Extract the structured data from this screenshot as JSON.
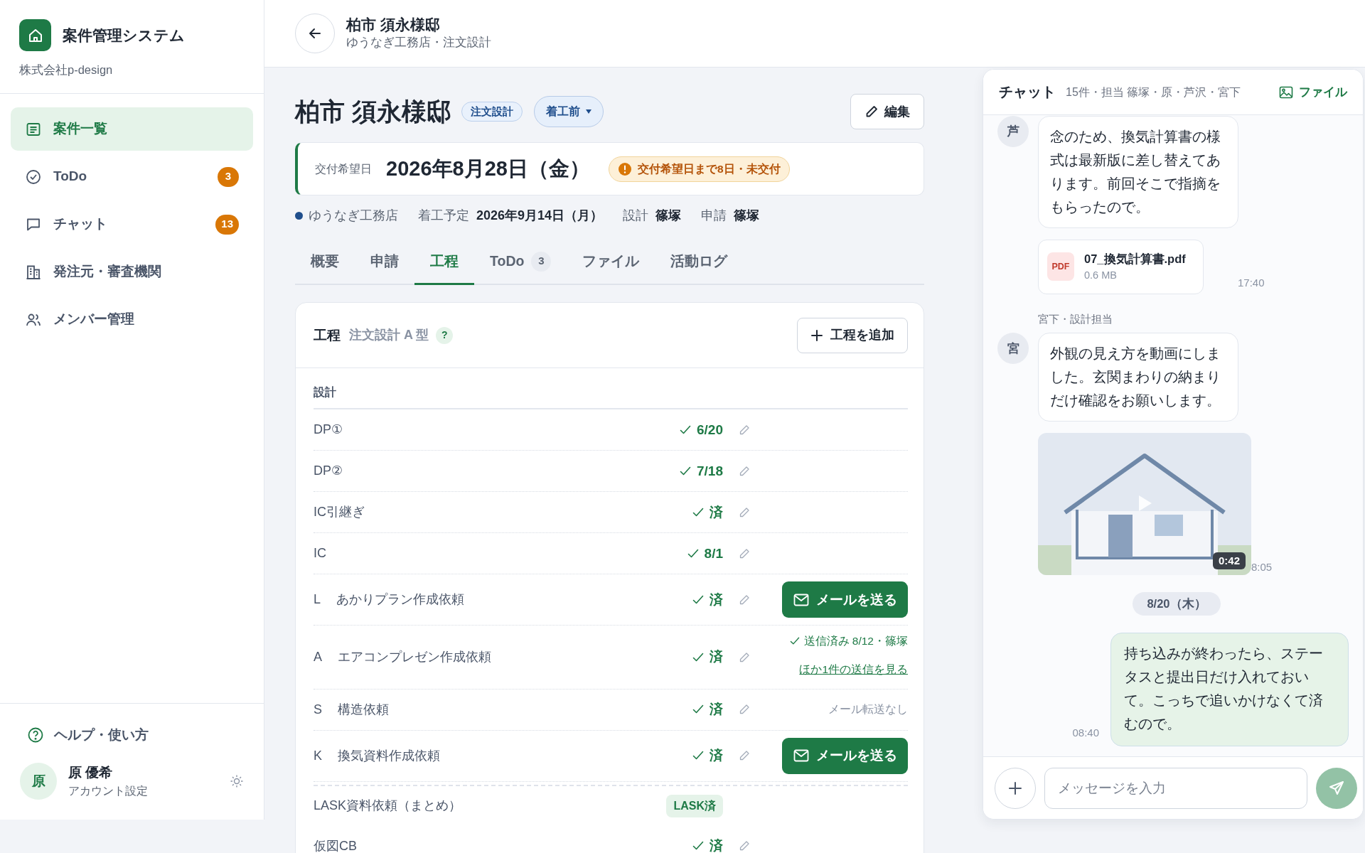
{
  "sidebar": {
    "app_title": "案件管理システム",
    "company": "株式会社p-design",
    "items": [
      {
        "label": "案件一覧",
        "selected": true
      },
      {
        "label": "ToDo",
        "selected": false,
        "count": "3"
      },
      {
        "label": "チャット",
        "selected": false,
        "count": "13"
      },
      {
        "label": "発注元・審査機関",
        "selected": false
      },
      {
        "label": "メンバー管理",
        "selected": false
      }
    ],
    "help": "ヘルプ・使い方",
    "user": {
      "avatar": "原",
      "name": "原 優希",
      "link": "アカウント設定"
    }
  },
  "header": {
    "title": "柏市 須永様邸",
    "subtitle": "ゆうなぎ工務店・注文設計"
  },
  "project": {
    "title": "柏市 須永様邸",
    "tag": "注文設計",
    "status": "着工前",
    "edit": "編集",
    "delivery": {
      "label": "交付希望日",
      "date": "2026年8月28日（金）",
      "warning": "交付希望日まで8日・未交付"
    },
    "company": {
      "name": "ゆうなぎ工務店",
      "color": "#1f4e8c"
    },
    "fields": [
      {
        "label": "着工予定",
        "value": "2026年9月14日（月）"
      },
      {
        "label": "設計",
        "value": "篠塚"
      },
      {
        "label": "申請",
        "value": "篠塚"
      }
    ]
  },
  "tabs": [
    {
      "label": "概要",
      "selected": false
    },
    {
      "label": "申請",
      "selected": false
    },
    {
      "label": "工程",
      "selected": true
    },
    {
      "label": "ToDo",
      "selected": false,
      "count": "3"
    },
    {
      "label": "ファイル",
      "selected": false
    },
    {
      "label": "活動ログ",
      "selected": false
    }
  ],
  "process": {
    "title": "工程",
    "template": "注文設計 A 型",
    "help": "?",
    "add": "工程を追加",
    "section": "設計",
    "rows": [
      {
        "kind": "step",
        "name": "DP①",
        "status": "6/20"
      },
      {
        "kind": "step",
        "name": "DP②",
        "status": "7/18"
      },
      {
        "kind": "step",
        "name": "IC引継ぎ",
        "status": "済"
      },
      {
        "kind": "step",
        "name": "IC",
        "status": "8/1"
      },
      {
        "kind": "step",
        "code": "L",
        "name": "あかりプラン作成依頼",
        "status": "済",
        "action": {
          "kind": "mail_button",
          "label": "メールを送る"
        }
      },
      {
        "kind": "step",
        "code": "A",
        "name": "エアコンプレゼン作成依頼",
        "status": "済",
        "action": {
          "kind": "sent",
          "text": "送信済み 8/12・篠塚",
          "link": "ほか1件の送信を見る"
        }
      },
      {
        "kind": "step",
        "code": "S",
        "name": "構造依頼",
        "status": "済",
        "action": {
          "kind": "note",
          "text": "メール転送なし"
        }
      },
      {
        "kind": "step",
        "code": "K",
        "name": "換気資料作成依頼",
        "status": "済",
        "action": {
          "kind": "mail_button",
          "label": "メールを送る"
        }
      },
      {
        "kind": "summary",
        "name": "LASK資料依頼（まとめ）",
        "status": "LASK済"
      },
      {
        "kind": "step",
        "name": "仮図CB",
        "status": "済"
      }
    ]
  },
  "chat": {
    "title": "チャット",
    "summary": "15件・担当 篠塚・原・芦沢・宮下",
    "files": "ファイル",
    "messages": [
      {
        "kind": "text_in",
        "avatar": "芦",
        "text": "念のため、換気計算書の様式は最新版に差し替えてあります。前回そこで指摘をもらったので。"
      },
      {
        "kind": "file",
        "badge": "PDF",
        "name": "07_換気計算書.pdf",
        "size": "0.6 MB",
        "time": "17:40"
      },
      {
        "kind": "sender",
        "text": "宮下・設計担当"
      },
      {
        "kind": "text_in",
        "avatar": "宮",
        "text": "外観の見え方を動画にしました。玄関まわりの納まりだけ確認をお願いします。"
      },
      {
        "kind": "video",
        "duration": "0:42",
        "time": "8:05"
      },
      {
        "kind": "date",
        "text": "8/20（木）"
      },
      {
        "kind": "text_out",
        "text": "持ち込みが終わったら、ステータスと提出日だけ入れておいて。こっちで追いかけなくて済むので。",
        "time": "08:40"
      }
    ],
    "placeholder": "メッセージを入力"
  }
}
